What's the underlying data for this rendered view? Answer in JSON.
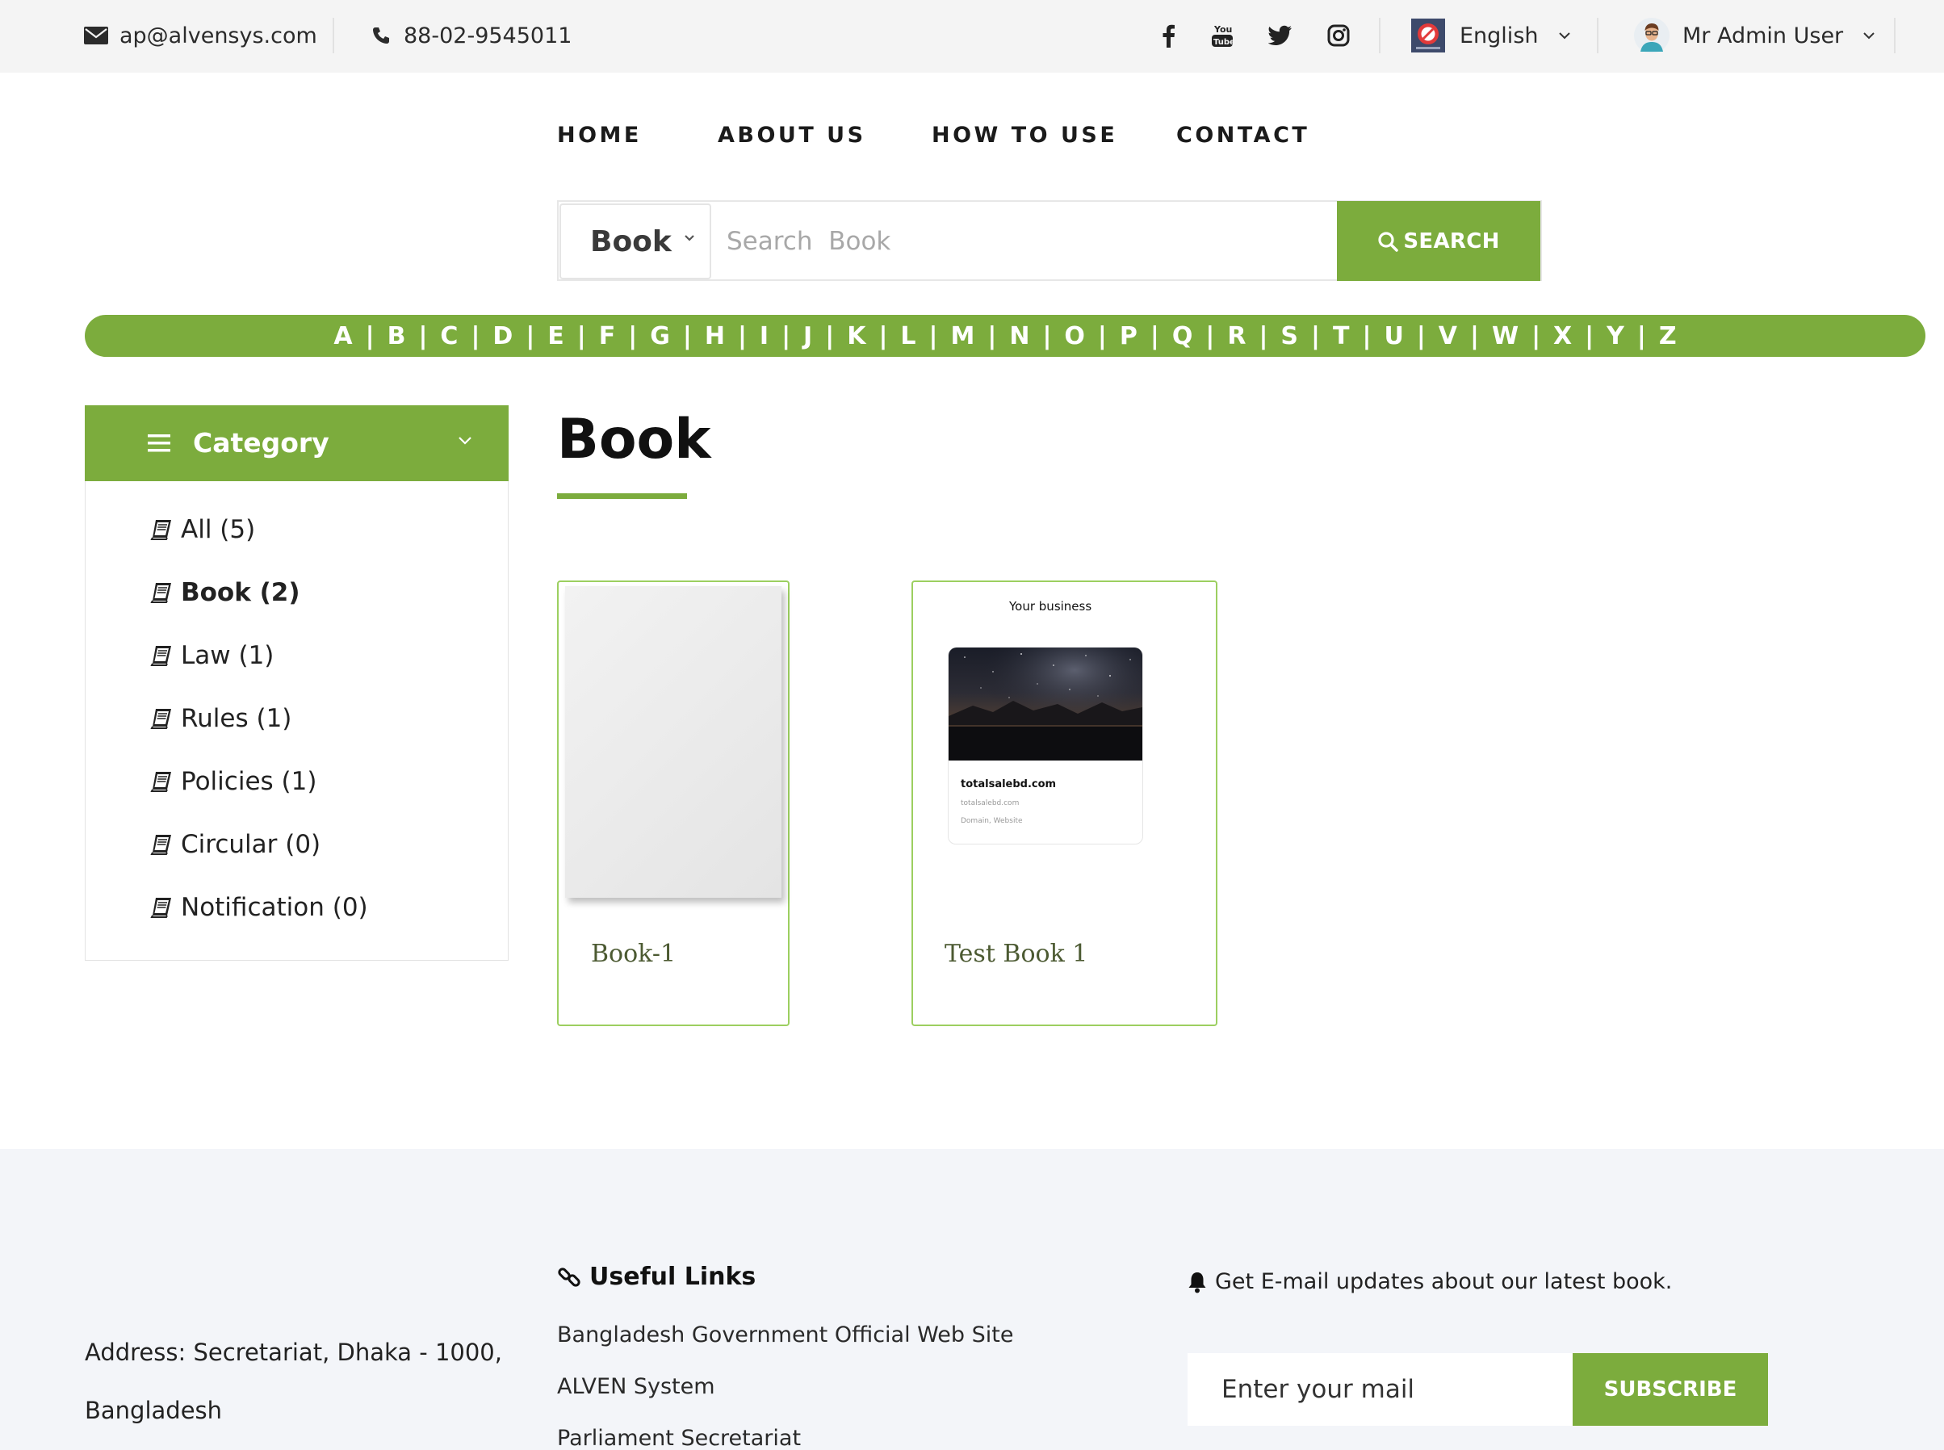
{
  "topbar": {
    "email": "ap@alvensys.com",
    "phone": "88-02-9545011",
    "social": [
      "facebook-icon",
      "youtube-icon",
      "twitter-icon",
      "instagram-icon"
    ],
    "language": "English",
    "user": "Mr Admin User"
  },
  "nav": {
    "home": "HOME",
    "about": "ABOUT US",
    "how_to_use": "HOW TO USE",
    "contact": "CONTACT"
  },
  "search": {
    "type_selected": "Book",
    "placeholder": "Search  Book",
    "button_label": "SEARCH"
  },
  "alphabet": [
    "A",
    "B",
    "C",
    "D",
    "E",
    "F",
    "G",
    "H",
    "I",
    "J",
    "K",
    "L",
    "M",
    "N",
    "O",
    "P",
    "Q",
    "R",
    "S",
    "T",
    "U",
    "V",
    "W",
    "X",
    "Y",
    "Z"
  ],
  "sidebar": {
    "header": "Category",
    "items": [
      {
        "label": "All (5)",
        "active": false
      },
      {
        "label": "Book (2)",
        "active": true
      },
      {
        "label": "Law (1)",
        "active": false
      },
      {
        "label": "Rules (1)",
        "active": false
      },
      {
        "label": "Policies (1)",
        "active": false
      },
      {
        "label": "Circular (0)",
        "active": false
      },
      {
        "label": "Notification (0)",
        "active": false
      }
    ]
  },
  "main": {
    "title": "Book",
    "books": [
      {
        "title": "Book-1"
      },
      {
        "title": "Test Book 1",
        "cover": {
          "heading": "Your business",
          "site": "totalsalebd.com",
          "site_small": "totalsalebd.com",
          "tags": "Domain, Website"
        }
      }
    ]
  },
  "footer": {
    "address_line1": "Address: Secretariat, Dhaka - 1000,",
    "address_line2": "Bangladesh",
    "links_title": "Useful Links",
    "links": [
      "Bangladesh Government Official Web Site",
      "ALVEN System",
      "Parliament Secretariat"
    ],
    "newsletter_text": "Get E-mail updates about our latest book.",
    "email_placeholder": "Enter your mail",
    "subscribe_label": "SUBSCRIBE"
  },
  "colors": {
    "accent": "#7cac3d",
    "card_border": "#9ccf60",
    "footer_bg": "#f3f5f9",
    "topbar_bg": "#f4f4f4"
  }
}
